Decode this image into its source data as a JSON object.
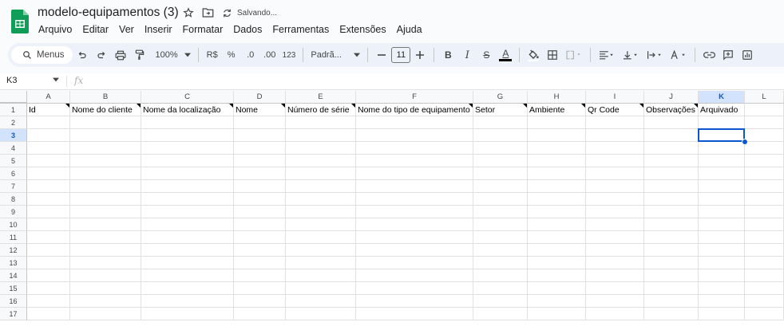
{
  "app": {
    "doc_title": "modelo-equipamentos (3)",
    "saving_status": "Salvando..."
  },
  "menu": [
    "Arquivo",
    "Editar",
    "Ver",
    "Inserir",
    "Formatar",
    "Dados",
    "Ferramentas",
    "Extensões",
    "Ajuda"
  ],
  "toolbar": {
    "search_label": "Menus",
    "zoom": "100%",
    "currency": "R$",
    "percent": "%",
    "dec_decrease": ".0",
    "dec_increase": ".00",
    "number_format": "123",
    "font_name": "Padrã...",
    "font_size": "11",
    "bold": "B",
    "italic": "I",
    "strike": "S",
    "text_color": "A"
  },
  "formula_bar": {
    "name_box": "K3",
    "fx": "fx"
  },
  "sheet": {
    "selected_cell": "K3",
    "columns": [
      "A",
      "B",
      "C",
      "D",
      "E",
      "F",
      "G",
      "H",
      "I",
      "J",
      "K",
      "L"
    ],
    "rows": [
      "1",
      "2",
      "3",
      "4",
      "5",
      "6",
      "7",
      "8",
      "9",
      "10",
      "11",
      "12",
      "13",
      "14",
      "15",
      "16",
      "17"
    ],
    "header_row": [
      "Id",
      "Nome do cliente",
      "Nome da localização",
      "Nome",
      "Número de série",
      "Nome do tipo de equipamento",
      "Setor",
      "Ambiente",
      "Qr Code",
      "Observações",
      "Arquivado",
      ""
    ]
  }
}
